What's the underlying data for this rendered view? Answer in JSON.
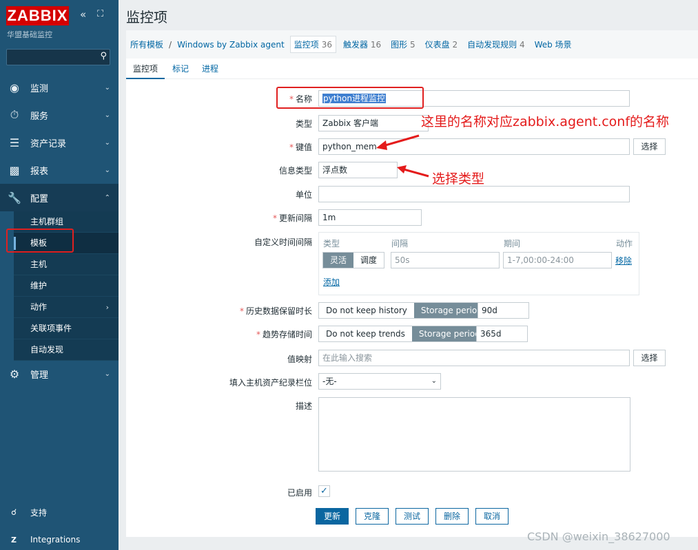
{
  "sidebar": {
    "logo": "ZABBIX",
    "subtitle": "华盟基础监控",
    "collapse_icon": "«",
    "expand_icon": "⛶",
    "search_icon": "search-icon",
    "menu": [
      {
        "label": "监测",
        "icon": "eye-icon"
      },
      {
        "label": "服务",
        "icon": "clock-icon"
      },
      {
        "label": "资产记录",
        "icon": "list-icon"
      },
      {
        "label": "报表",
        "icon": "bar-chart-icon"
      },
      {
        "label": "配置",
        "icon": "wrench-icon"
      },
      {
        "label": "管理",
        "icon": "gear-icon"
      }
    ],
    "config_items": [
      {
        "label": "主机群组"
      },
      {
        "label": "模板"
      },
      {
        "label": "主机"
      },
      {
        "label": "维护"
      },
      {
        "label": "动作"
      },
      {
        "label": "关联项事件"
      },
      {
        "label": "自动发现"
      }
    ],
    "footer": [
      {
        "label": "支持",
        "icon": "headset-icon"
      },
      {
        "label": "Integrations",
        "icon": "zabbix-z-icon"
      }
    ]
  },
  "page": {
    "title": "监控项"
  },
  "breadcrumb": {
    "all_templates": "所有模板",
    "sep": "/",
    "template": "Windows by Zabbix agent",
    "items_label": "监控项",
    "items_count": "36",
    "triggers_label": "触发器",
    "triggers_count": "16",
    "graphs_label": "图形",
    "graphs_count": "5",
    "dashboards_label": "仪表盘",
    "dashboards_count": "2",
    "discovery_label": "自动发现规则",
    "discovery_count": "4",
    "web_label": "Web 场景"
  },
  "tabs": [
    {
      "label": "监控项"
    },
    {
      "label": "标记"
    },
    {
      "label": "进程"
    }
  ],
  "form": {
    "name_label": "名称",
    "name_value": "python进程监控",
    "type_label": "类型",
    "type_value": "Zabbix 客户端",
    "key_label": "键值",
    "key_value": "python_mem",
    "select_label": "选择",
    "info_type_label": "信息类型",
    "info_type_value": "浮点数",
    "units_label": "单位",
    "units_value": "",
    "interval_label": "更新间隔",
    "interval_value": "1m",
    "custom_label": "自定义时间间隔",
    "custom": {
      "col_type": "类型",
      "col_interval": "间隔",
      "col_period": "期间",
      "col_action": "动作",
      "flexible": "灵活",
      "scheduling": "调度",
      "interval_value": "50s",
      "period_value": "1-7,00:00-24:00",
      "remove": "移除",
      "add": "添加"
    },
    "history_label": "历史数据保留时长",
    "history_no": "Do not keep history",
    "history_storage": "Storage period",
    "history_value": "90d",
    "trends_label": "趋势存储时间",
    "trends_no": "Do not keep trends",
    "trends_storage": "Storage period",
    "trends_value": "365d",
    "valuemap_label": "值映射",
    "valuemap_placeholder": "在此输入搜索",
    "inventory_label": "填入主机资产纪录栏位",
    "inventory_value": "-无-",
    "desc_label": "描述",
    "enabled_label": "已启用",
    "buttons": {
      "update": "更新",
      "clone": "克隆",
      "test": "测试",
      "delete": "删除",
      "cancel": "取消"
    }
  },
  "annotations": {
    "name_note": "这里的名称对应zabbix.agent.conf的名称",
    "type_note": "选择类型"
  },
  "watermark": "CSDN @weixin_38627000",
  "colors": {
    "sidebar": "#1f5475",
    "accent": "#0a66a0",
    "annotation": "#e41b1b",
    "logo": "#d40000"
  }
}
